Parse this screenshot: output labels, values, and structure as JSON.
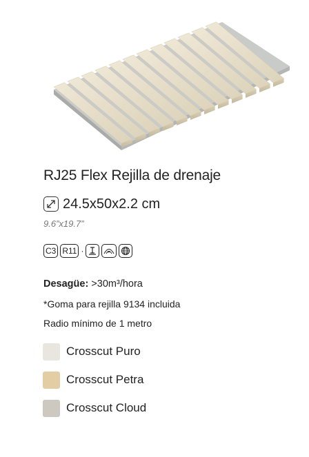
{
  "product": {
    "title": "RJ25 Flex Rejilla de drenaje",
    "dimensions": "24.5x50x2.2 cm",
    "dimensions_inch": "9.6”x19.7”",
    "badges": [
      {
        "type": "text",
        "label": "C3"
      },
      {
        "type": "text",
        "label": "R11"
      },
      {
        "type": "separator",
        "label": "·"
      },
      {
        "type": "icon",
        "icon": "pedestrian-traffic-icon"
      },
      {
        "type": "icon",
        "icon": "frost-resistant-icon"
      },
      {
        "type": "icon",
        "icon": "globe-icon"
      }
    ],
    "drain_label": "Desagüe:",
    "drain_value": " >30m³/hora",
    "goma_note": "*Goma para rejilla 9134 incluida",
    "radio_note": "Radio mínimo de 1 metro"
  },
  "finishes": [
    {
      "label": "Crosscut Puro",
      "color": "#e9e6e0"
    },
    {
      "label": "Crosscut Petra",
      "color": "#e2cda4"
    },
    {
      "label": "Crosscut Cloud",
      "color": "#cdc8c0"
    }
  ],
  "colors": {
    "stone": "#e7dfc9",
    "stone_shadow": "#cfc5ab",
    "rubber": "#b9bbb8"
  }
}
